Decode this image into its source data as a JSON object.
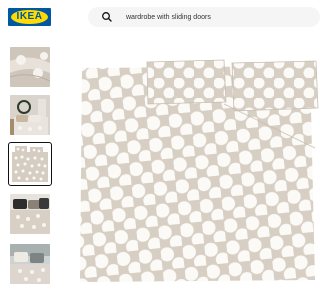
{
  "header": {
    "logo_text": "IKEA",
    "search": {
      "query": "wardrobe with sliding doors",
      "icon": "search-icon"
    }
  },
  "gallery": {
    "thumbnails": [
      {
        "name": "close-up bedding texture",
        "selected": false
      },
      {
        "name": "bedroom scene with wreath",
        "selected": false
      },
      {
        "name": "duvet cover and pillowcases product",
        "selected": true
      },
      {
        "name": "bed with dark pillows",
        "selected": false
      },
      {
        "name": "bed with patterned cushions",
        "selected": false
      }
    ]
  },
  "main_image": {
    "name": "duvet cover and pillowcases, beige with white dots"
  },
  "colors": {
    "brand_blue": "#0058a3",
    "brand_yellow": "#ffdb00",
    "fabric_beige": "#d8cfc4",
    "dot_white": "#fbfaf7"
  }
}
